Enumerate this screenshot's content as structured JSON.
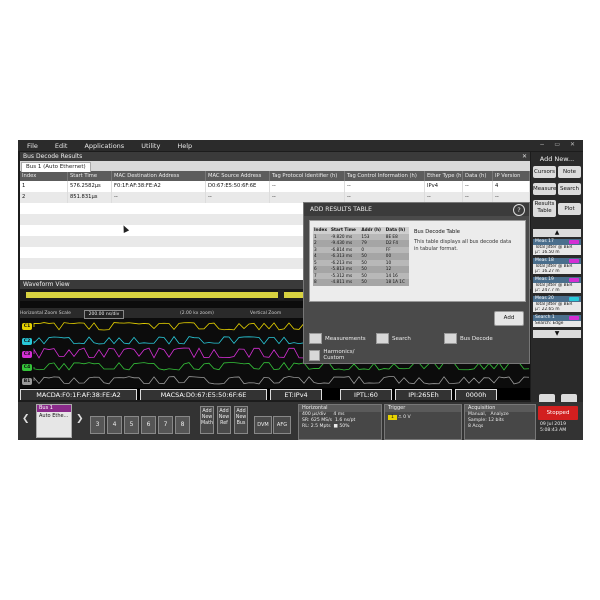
{
  "menu": [
    "File",
    "Edit",
    "Applications",
    "Utility",
    "Help"
  ],
  "bus_decode": {
    "title": "Bus Decode Results",
    "tab": "Bus 1 (Auto Ethernet)",
    "columns": [
      "Index",
      "Start Time",
      "MAC Destination Address",
      "MAC Source Address",
      "Tag Protocol Identifier (h)",
      "Tag Control Information (h)",
      "Ether Type (h)",
      "Data (h)",
      "IP Version"
    ],
    "rows": [
      [
        "1",
        "576.2582µs",
        "F0:1F:AF:38:FE:A2",
        "D0:67:E5:50:6F:6E",
        "--",
        "--",
        "IPv4",
        "--",
        "4"
      ],
      [
        "2",
        "851.831µs",
        "--",
        "--",
        "--",
        "--",
        "--",
        "--",
        "--"
      ]
    ]
  },
  "dialog": {
    "title": "ADD RESULTS TABLE",
    "help": "?",
    "mini_table": {
      "headers": [
        "Index",
        "Start Time",
        "Addr (h)",
        "Data (h)"
      ],
      "rows": [
        [
          "1",
          "-9.820 ms",
          "153",
          "8E E8"
        ],
        [
          "2",
          "-9.430 ms",
          "79",
          "D2 F4"
        ],
        [
          "3",
          "-6.814 ms",
          "0",
          "FF"
        ],
        [
          "4",
          "-6.313 ms",
          "50",
          "00"
        ],
        [
          "5",
          "-6.213 ms",
          "50",
          "10"
        ],
        [
          "6",
          "-5.813 ms",
          "50",
          "12"
        ],
        [
          "7",
          "-5.312 ms",
          "50",
          "14 16"
        ],
        [
          "8",
          "-4.811 ms",
          "50",
          "18 1A 1C"
        ]
      ]
    },
    "desc_title": "Bus Decode Table",
    "desc": "This table displays all bus decode data in tabular format.",
    "add_label": "Add",
    "options": {
      "measurements": "Measurements",
      "search": "Search",
      "bus_decode": "Bus Decode",
      "harmonics": "Harmonics/ Custom"
    }
  },
  "waveform": {
    "title": "Waveform View",
    "zone_label": "Horizontal Zoom Scale",
    "zone_value": "200.00 ns/div",
    "zoom_text": "(2.00 kx zoom)",
    "vz_label": "Vertical Zoom",
    "channels": [
      {
        "label": "C1",
        "color": "#e6d200"
      },
      {
        "label": "C2",
        "color": "#29c9d9"
      },
      {
        "label": "C3",
        "color": "#d42fd4"
      },
      {
        "label": "C4",
        "color": "#35c43a"
      },
      {
        "label": "B1",
        "color": "#9a9a9a"
      }
    ],
    "decode_segments": [
      "MACDA:F0:1F:AF:38:FE:A2",
      "MACSA:D0:67:E5:50:6F:6E",
      "ET:IPv4",
      "IPTL:60",
      "IPI:265Eh",
      "0000h"
    ]
  },
  "right_panel": {
    "title": "Add New...",
    "buttons": [
      "Cursors",
      "Note",
      "Measure",
      "Search",
      "Results Table",
      "Plot"
    ],
    "measurements": [
      {
        "title": "Meas 17",
        "line1": "Total Jitter @ BER",
        "line2": "µ': 16.50 m",
        "tag": "#d42fd4"
      },
      {
        "title": "Meas 18",
        "line1": "Total Jitter @ BER",
        "line2": "µ': 16.27 m",
        "tag": "#d42fd4"
      },
      {
        "title": "Meas 19",
        "line1": "Total Jitter @ BER",
        "line2": "µ': 247.7 m",
        "tag": "#d42fd4"
      },
      {
        "title": "Meas 20",
        "line1": "Total Jitter @ BER",
        "line2": "µ': 22.65 m",
        "tag": "#29c9d9"
      },
      {
        "title": "Search 1",
        "line1": "Search: Edge",
        "line2": "",
        "tag": "#d42fd4"
      }
    ],
    "up_arrow": "▲",
    "down_arrow": "▼"
  },
  "bottom": {
    "bus": {
      "title": "Bus 1",
      "value": "Auto Ethe..."
    },
    "channels": [
      "3",
      "4",
      "5",
      "6",
      "7",
      "8"
    ],
    "add_math": "Add New Math",
    "add_ref": "Add New Ref",
    "add_bus": "Add New Bus",
    "dvm": "DVM",
    "afg": "AFG",
    "horizontal": {
      "title": "Horizontal",
      "l1": "400 µs/div",
      "l1b": "4 ms",
      "l2": "SR: 625 MS/s",
      "l2b": "1.6 ns/pt",
      "l3": "RL: 2.5 Mpts",
      "l3b": "■ 50%"
    },
    "trigger": {
      "title": "Trigger",
      "ch": "1",
      "val": "0 V"
    },
    "acquisition": {
      "title": "Acquisition",
      "l1": "Manual,",
      "l1b": "Analyze",
      "l2": "Sample: 12 bits",
      "l3": "8 Acqs"
    },
    "stopped": "Stopped",
    "date": "09 Jul 2019",
    "time": "5:08:43 AM"
  }
}
